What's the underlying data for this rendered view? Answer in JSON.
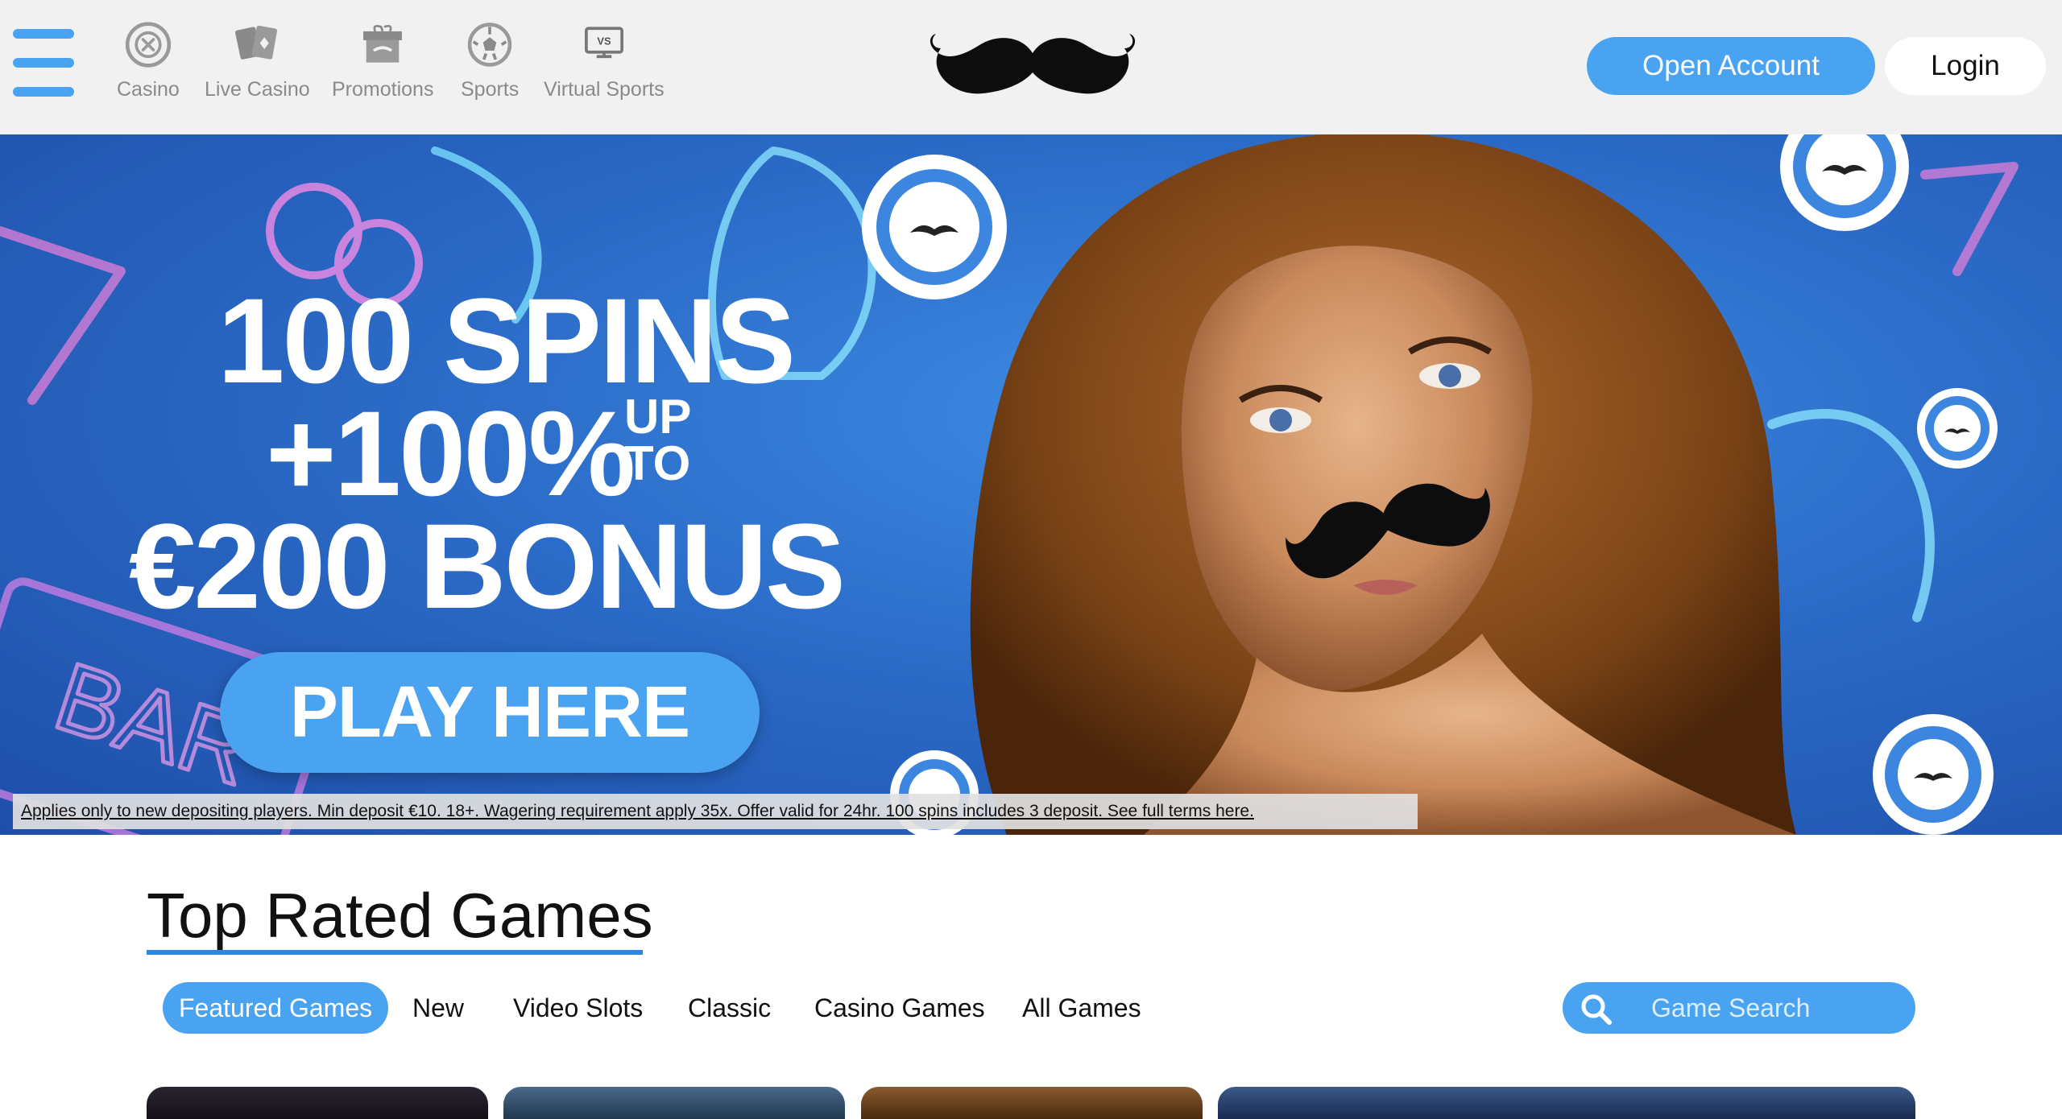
{
  "header": {
    "menu_icon": "hamburger-menu-icon",
    "nav": [
      {
        "label": "Casino",
        "icon": "roulette-icon"
      },
      {
        "label": "Live Casino",
        "icon": "playing-cards-icon"
      },
      {
        "label": "Promotions",
        "icon": "gift-box-icon"
      },
      {
        "label": "Sports",
        "icon": "soccer-ball-icon"
      },
      {
        "label": "Virtual Sports",
        "icon": "vs-monitor-icon"
      }
    ],
    "logo_icon": "mustache-logo-icon",
    "open_account_label": "Open Account",
    "login_label": "Login"
  },
  "hero": {
    "line1": "100 SPINS",
    "line2": "+100%",
    "line2_up": "UP",
    "line2_to": "TO",
    "line3": "€200 BONUS",
    "cta_label": "PLAY HERE",
    "terms": "Applies only to new depositing players. Min deposit €10. 18+. Wagering requirement apply 35x. Offer valid for 24hr. 100 spins includes 3 deposit. See full terms here."
  },
  "games": {
    "title": "Top Rated Games",
    "tabs": [
      "Featured Games",
      "New",
      "Video Slots",
      "Classic",
      "Casino Games",
      "All Games"
    ],
    "active_tab": "Featured Games",
    "search_placeholder": "Game Search",
    "search_icon": "search-icon"
  },
  "colors": {
    "accent": "#4aa3f0",
    "header_bg": "#f1f1f1",
    "hero_blue": "#2b6cc8",
    "nav_gray": "#8a8a8a"
  }
}
